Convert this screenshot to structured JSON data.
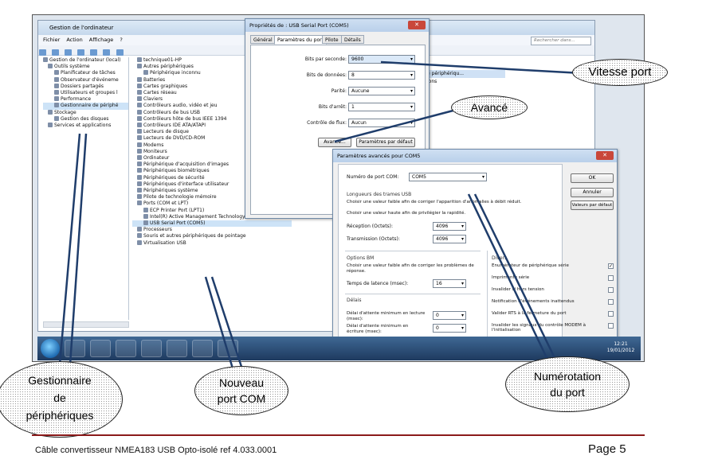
{
  "cm": {
    "title": "Gestion de l'ordinateur",
    "menu": [
      "Fichier",
      "Action",
      "Affichage",
      "?"
    ],
    "left_tree": [
      "Gestion de l'ordinateur (local)",
      "Outils système",
      "Planificateur de tâches",
      "Observateur d'événeme",
      "Dossiers partagés",
      "Utilisateurs et groupes l",
      "Performance",
      "Gestionnaire de périphé",
      "Stockage",
      "Gestion des disques",
      "Services et applications"
    ],
    "device_tree": [
      "technique01-HP",
      "Autres périphériques",
      "Périphérique inconnu",
      "Batteries",
      "Cartes graphiques",
      "Cartes réseau",
      "Claviers",
      "Contrôleurs audio, vidéo et jeu",
      "Contrôleurs de bus USB",
      "Contrôleurs hôte de bus IEEE 1394",
      "Contrôleurs IDE ATA/ATAPI",
      "Lecteurs de disque",
      "Lecteurs de DVD/CD-ROM",
      "Modems",
      "Moniteurs",
      "Ordinateur",
      "Périphérique d'acquisition d'images",
      "Périphériques biométriques",
      "Périphériques de sécurité",
      "Périphériques d'interface utilisateur",
      "Périphériques système",
      "Pilote de technologie mémoire",
      "Ports (COM et LPT)",
      "ECP Printer Port (LPT1)",
      "Intel(R) Active Management Technology - SOL (COM4)",
      "USB Serial Port (COM5)",
      "Processeurs",
      "Souris et autres périphériques de pointage",
      "Virtualisation USB"
    ],
    "actions_items": [
      "e périphériqu...",
      "ions"
    ],
    "search_placeholder": "Rechercher dans..."
  },
  "props": {
    "title": "Propriétés de : USB Serial Port (COM5)",
    "tabs": [
      "Général",
      "Paramètres du port",
      "Pilote",
      "Détails"
    ],
    "fields": [
      {
        "label": "Bits par seconde:",
        "value": "9600"
      },
      {
        "label": "Bits de données:",
        "value": "8"
      },
      {
        "label": "Parité:",
        "value": "Aucune"
      },
      {
        "label": "Bits d'arrêt:",
        "value": "1"
      },
      {
        "label": "Contrôle de flux:",
        "value": "Aucun"
      }
    ],
    "advanced_button": "Avancé...",
    "defaults_button": "Paramètres par défaut"
  },
  "adv": {
    "title": "Paramètres avancés pour COM5",
    "com_label": "Numéro de port COM:",
    "com_value": "COM5",
    "usb_section": "Longueurs des trames USB",
    "usb_text1": "Choisir une valeur faible afin de corriger l'apparition d'anomalies à débit réduit.",
    "usb_text2": "Choisir une valeur haute afin de privilégier la rapidité.",
    "rx_label": "Réception (Octets):",
    "rx_value": "4096",
    "tx_label": "Transmission (Octets):",
    "tx_value": "4096",
    "bm_section": "Options BM",
    "bm_text": "Choisir une valeur faible afin de corriger les problèmes de réponse.",
    "latency_label": "Temps de latence (msec):",
    "latency_value": "16",
    "delays_section": "Délais",
    "read_label": "Délai d'attente minimum en lecture (msec):",
    "read_value": "0",
    "write_label": "Délai d'attente minimum en écriture (msec):",
    "write_value": "0",
    "misc_section": "Divers",
    "misc": [
      {
        "label": "Enumérateur de périphérique série",
        "checked": true
      },
      {
        "label": "Imprimante série",
        "checked": false
      },
      {
        "label": "Invalider si hors tension",
        "checked": false
      },
      {
        "label": "Notification d'événements inattendus",
        "checked": false
      },
      {
        "label": "Valider RTS à la fermeture du port",
        "checked": false
      },
      {
        "label": "Invalider les signaux du contrôle MODEM à l'initialisation",
        "checked": false
      }
    ],
    "ok": "OK",
    "cancel": "Annuler",
    "defaults": "Valeurs par défaut"
  },
  "clock": {
    "time": "12:21",
    "date": "19/01/2012"
  },
  "callouts": {
    "speed": "Vitesse port",
    "advanced": "Avancé",
    "device_manager": [
      "Gestionnaire",
      "de",
      "périphériques"
    ],
    "new_port": [
      "Nouveau",
      "port COM"
    ],
    "numbering": [
      "Numérotation",
      "du port"
    ]
  },
  "footer": {
    "left": "Câble convertisseur NMEA183 USB Opto-isolé  ref 4.033.0001",
    "page": "Page 5"
  }
}
